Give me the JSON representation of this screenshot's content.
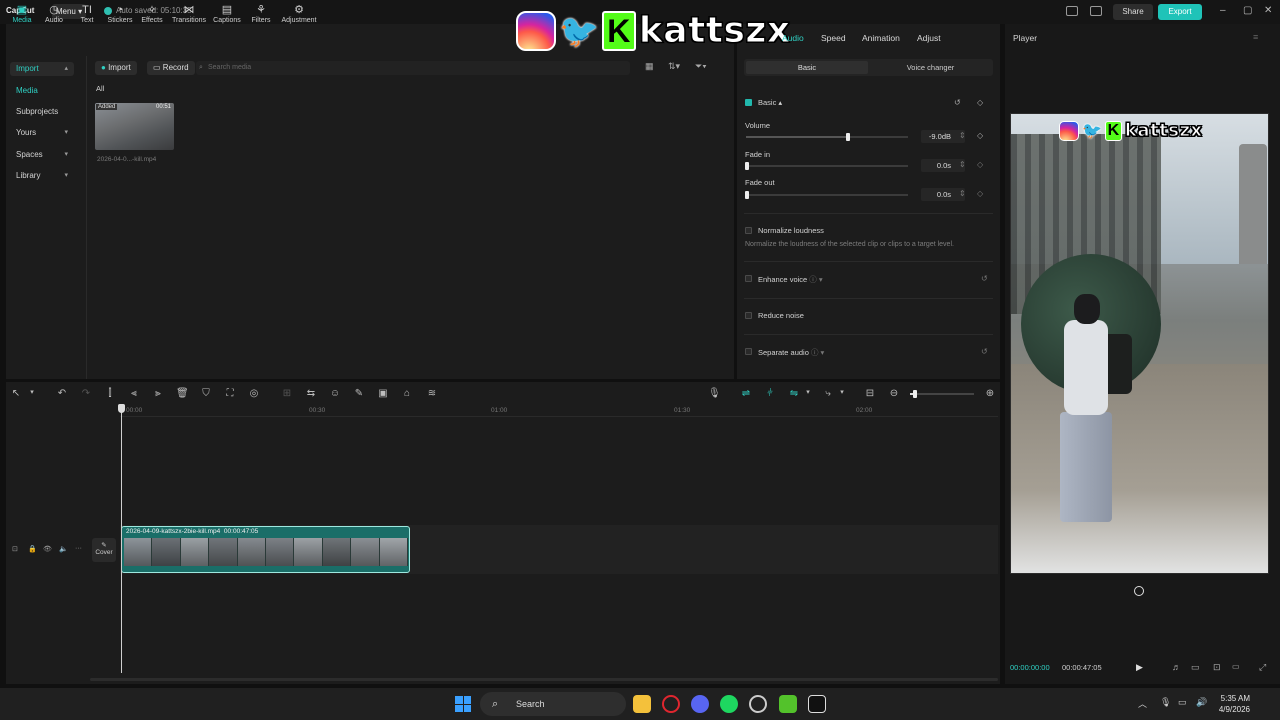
{
  "titlebar": {
    "app_name": "CapCut",
    "menu_label": "Menu",
    "autosave": "Auto saved: 05:10:35",
    "share_label": "Share",
    "export_label": "Export",
    "minimize": "–",
    "maximize": "▢",
    "close": "✕"
  },
  "toolbar": {
    "tools": [
      {
        "label": "Media",
        "icon": "media-icon"
      },
      {
        "label": "Audio",
        "icon": "audio-icon"
      },
      {
        "label": "Text",
        "icon": "text-icon"
      },
      {
        "label": "Stickers",
        "icon": "stickers-icon"
      },
      {
        "label": "Effects",
        "icon": "effects-icon"
      },
      {
        "label": "Transitions",
        "icon": "transitions-icon"
      },
      {
        "label": "Captions",
        "icon": "captions-icon"
      },
      {
        "label": "Filters",
        "icon": "filters-icon"
      },
      {
        "label": "Adjustment",
        "icon": "adjustment-icon"
      }
    ]
  },
  "sidebar": {
    "items": [
      {
        "label": "Import"
      },
      {
        "label": "Media"
      },
      {
        "label": "Subprojects"
      },
      {
        "label": "Yours"
      },
      {
        "label": "Spaces"
      },
      {
        "label": "Library"
      }
    ]
  },
  "media": {
    "import_label": "Import",
    "record_label": "Record",
    "search_placeholder": "Search media",
    "filter_all": "All",
    "item": {
      "badge": "Added",
      "duration": "00:51",
      "filename": "2026-04-0...-kill.mp4"
    }
  },
  "inspector": {
    "tabs": [
      "Audio",
      "Speed",
      "Animation",
      "Adjust"
    ],
    "active_tab": "Audio",
    "segments": {
      "basic": "Basic",
      "voice_changer": "Voice changer"
    },
    "basic_header": "Basic",
    "volume": {
      "label": "Volume",
      "value": "-9.0dB"
    },
    "fade_in": {
      "label": "Fade in",
      "value": "0.0s"
    },
    "fade_out": {
      "label": "Fade out",
      "value": "0.0s"
    },
    "normalize": {
      "label": "Normalize loudness",
      "desc": "Normalize the loudness of the selected clip or clips to a target level."
    },
    "enhance_voice": "Enhance voice",
    "reduce_noise": "Reduce noise",
    "separate_audio": "Separate audio"
  },
  "player": {
    "title": "Player",
    "current_time": "00:00:00:00",
    "total_time": "00:00:47:05"
  },
  "watermark": {
    "handle": "kattszx",
    "k_letter": "K",
    "twitter_glyph": "🐦"
  },
  "timeline": {
    "ruler": [
      "00:00",
      "00:30",
      "01:00",
      "01:30",
      "02:00"
    ],
    "clip_label": "2026-04-09-kattszx-2bie-kill.mp4",
    "clip_duration": "00:00:47:05",
    "cover_label": "Cover"
  },
  "taskbar": {
    "search_label": "Search",
    "time": "5:35 AM",
    "date": "4/9/2026"
  },
  "colors": {
    "accent": "#2fd0c3",
    "export": "#1fc3b8",
    "panel": "#1c1c1c",
    "background": "#101010"
  }
}
